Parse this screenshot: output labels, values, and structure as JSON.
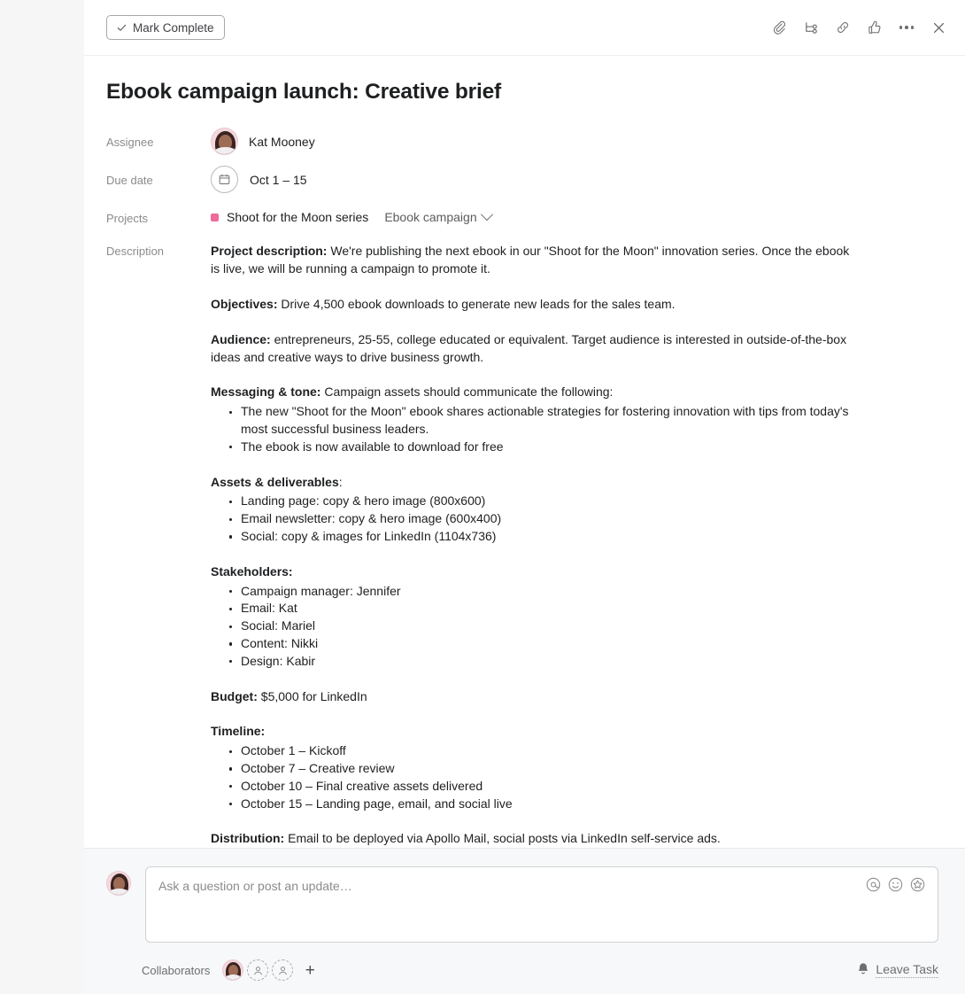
{
  "header": {
    "mark_complete_label": "Mark Complete",
    "actions": [
      {
        "name": "attach-icon",
        "label": "Attach"
      },
      {
        "name": "subtask-icon",
        "label": "Add subtask"
      },
      {
        "name": "link-icon",
        "label": "Copy task link"
      },
      {
        "name": "like-icon",
        "label": "Like"
      },
      {
        "name": "more-options-icon",
        "label": "More options"
      },
      {
        "name": "close-icon",
        "label": "Close"
      }
    ]
  },
  "task": {
    "title": "Ebook campaign launch: Creative brief",
    "fields": {
      "assignee_label": "Assignee",
      "assignee_name": "Kat Mooney",
      "due_date_label": "Due date",
      "due_date_value": "Oct 1 – 15",
      "projects_label": "Projects",
      "project_primary": "Shoot for the Moon series",
      "project_secondary": "Ebook campaign",
      "description_label": "Description"
    },
    "description": {
      "project_description_heading": "Project description:",
      "project_description_text": " We're publishing the next ebook in our \"Shoot for the Moon\" innovation series. Once the ebook is live, we will be running a campaign to promote it.",
      "objectives_heading": "Objectives:",
      "objectives_text": " Drive 4,500 ebook downloads to generate new leads for the sales team.",
      "audience_heading": "Audience:",
      "audience_text": " entrepreneurs, 25-55, college educated or equivalent. Target audience is interested in outside-of-the-box ideas and creative ways to drive business growth.",
      "messaging_heading": "Messaging & tone:",
      "messaging_text": " Campaign assets should communicate the following:",
      "messaging_items": [
        "The new \"Shoot for the Moon\" ebook shares actionable strategies for fostering innovation with tips from today's most successful business leaders.",
        "The ebook is now available to download for free"
      ],
      "assets_heading": "Assets & deliverables",
      "assets_heading_suffix": ":",
      "assets_items": [
        "Landing page: copy & hero image (800x600)",
        "Email newsletter: copy & hero image (600x400)",
        "Social: copy & images for LinkedIn (1104x736)"
      ],
      "stakeholders_heading": "Stakeholders:",
      "stakeholders_items": [
        "Campaign manager: Jennifer",
        "Email: Kat",
        "Social: Mariel",
        "Content: Nikki",
        "Design: Kabir"
      ],
      "budget_heading": "Budget:",
      "budget_text": " $5,000 for LinkedIn",
      "timeline_heading": "Timeline:",
      "timeline_items": [
        "October 1 – Kickoff",
        "October 7 – Creative review",
        "October 10 – Final creative assets delivered",
        "October 15 – Landing page, email, and social live"
      ],
      "distribution_heading": "Distribution:",
      "distribution_text": " Email to be deployed via Apollo Mail, social posts via LinkedIn self-service ads."
    }
  },
  "composer": {
    "placeholder": "Ask a question or post an update…",
    "value": "",
    "icons": [
      {
        "name": "mention-icon",
        "glyph": "@"
      },
      {
        "name": "emoji-icon",
        "glyph": "☺"
      },
      {
        "name": "sticker-icon",
        "glyph": "★"
      }
    ]
  },
  "footer": {
    "collaborators_label": "Collaborators",
    "add_collaborator_glyph": "+",
    "leave_task_label": "Leave Task"
  },
  "colors": {
    "project_dot": "#f06a9b",
    "panel_background": "#ffffff",
    "page_background": "#f6f6f7",
    "footer_background": "#f7f8f9",
    "text_primary": "#1e1f21",
    "text_muted": "#8a8b8d"
  }
}
